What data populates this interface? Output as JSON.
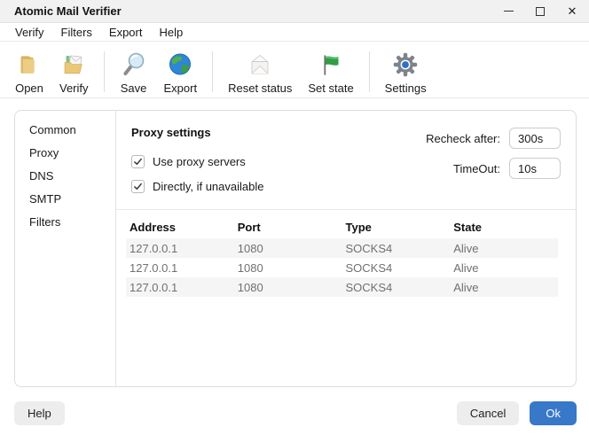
{
  "window": {
    "title": "Atomic Mail Verifier",
    "controls": {
      "minimize": "minimize",
      "maximize": "maximize",
      "close": "✕"
    }
  },
  "menu": {
    "items": [
      {
        "label": "Verify"
      },
      {
        "label": "Filters"
      },
      {
        "label": "Export"
      },
      {
        "label": "Help"
      }
    ]
  },
  "toolbar": {
    "items": [
      {
        "label": "Open",
        "icon": "folder-icon"
      },
      {
        "label": "Verify",
        "icon": "folder-mail-icon"
      },
      {
        "label": "Save",
        "icon": "magnifier-icon"
      },
      {
        "label": "Export",
        "icon": "globe-icon"
      },
      {
        "label": "Reset status",
        "icon": "envelope-icon"
      },
      {
        "label": "Set state",
        "icon": "flag-icon"
      },
      {
        "label": "Settings",
        "icon": "gear-icon"
      }
    ]
  },
  "sidebar": {
    "items": [
      {
        "label": "Common"
      },
      {
        "label": "Proxy"
      },
      {
        "label": "DNS"
      },
      {
        "label": "SMTP"
      },
      {
        "label": "Filters"
      }
    ],
    "selected": "Proxy"
  },
  "proxy_settings": {
    "title": "Proxy settings",
    "checkboxes": [
      {
        "label": "Use proxy servers",
        "checked": true
      },
      {
        "label": "Directly, if unavailable",
        "checked": true
      }
    ],
    "fields": [
      {
        "label": "Recheck after:",
        "value": "300s"
      },
      {
        "label": "TimeOut:",
        "value": "10s"
      }
    ],
    "table": {
      "columns": [
        "Address",
        "Port",
        "Type",
        "State"
      ],
      "rows": [
        [
          "127.0.0.1",
          "1080",
          "SOCKS4",
          "Alive"
        ],
        [
          "127.0.0.1",
          "1080",
          "SOCKS4",
          "Alive"
        ],
        [
          "127.0.0.1",
          "1080",
          "SOCKS4",
          "Alive"
        ]
      ]
    }
  },
  "footer": {
    "help_label": "Help",
    "cancel_label": "Cancel",
    "ok_label": "Ok"
  },
  "colors": {
    "accent": "#3778c9",
    "row_alt": "#f5f5f5",
    "titlebar_bg": "#f1f1f1",
    "flag_green": "#2f9e44"
  }
}
